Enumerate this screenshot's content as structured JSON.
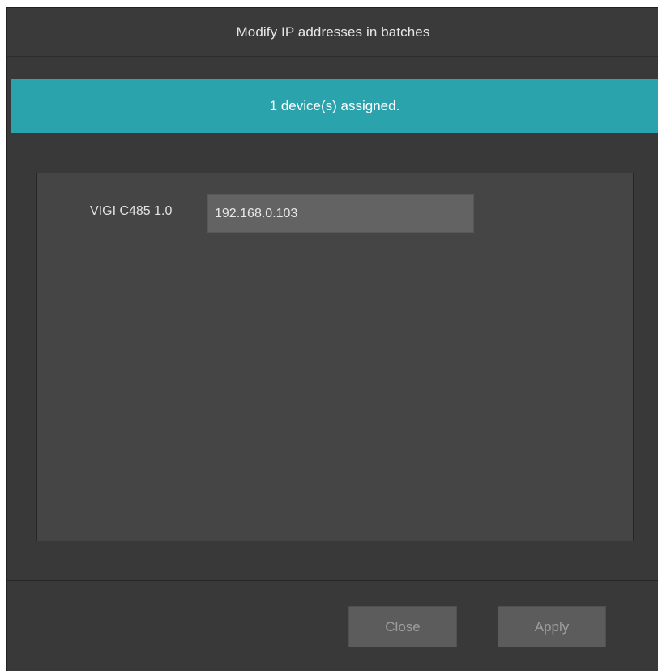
{
  "dialog": {
    "title": "Modify IP addresses in batches"
  },
  "banner": {
    "message": "1 device(s) assigned.",
    "color": "#2aa3ad"
  },
  "devices": [
    {
      "model": "VIGI C485 1.0",
      "ip": "192.168.0.103"
    }
  ],
  "footer": {
    "close_label": "Close",
    "apply_label": "Apply"
  }
}
